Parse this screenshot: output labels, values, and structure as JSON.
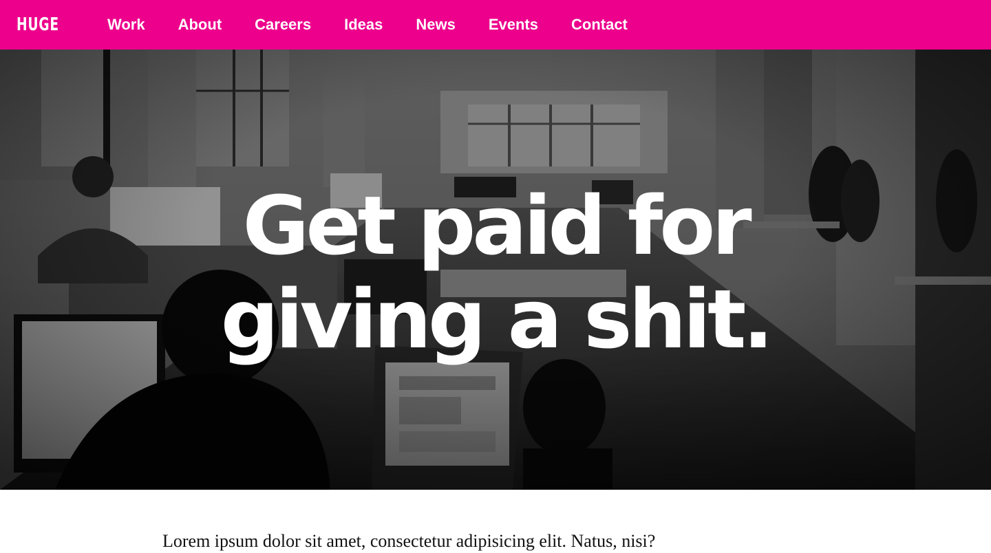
{
  "header": {
    "logo_text": "HUGE",
    "brand_color": "#ec008c",
    "nav": [
      {
        "label": "Work"
      },
      {
        "label": "About"
      },
      {
        "label": "Careers"
      },
      {
        "label": "Ideas"
      },
      {
        "label": "News"
      },
      {
        "label": "Events"
      },
      {
        "label": "Contact"
      }
    ]
  },
  "hero": {
    "headline_line1": "Get paid for",
    "headline_line2": "giving a shit.",
    "image_description": "office-photo"
  },
  "main": {
    "intro_text": "Lorem ipsum dolor sit amet, consectetur adipisicing elit. Natus, nisi?"
  }
}
